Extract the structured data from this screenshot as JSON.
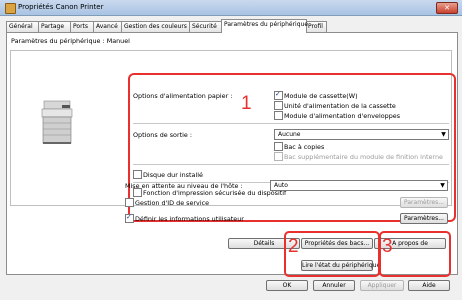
{
  "window": {
    "title": "Propriétés Canon Printer",
    "close_glyph": "✕"
  },
  "tabs": [
    "Général",
    "Partage",
    "Ports",
    "Avancé",
    "Gestion des couleurs",
    "Sécurité",
    "Paramètres du périphérique",
    "Profil"
  ],
  "panel": {
    "header": "Paramètres du périphérique : Manuel",
    "paper_source": {
      "label": "Options d'alimentation papier :",
      "options": [
        {
          "label": "Module de cassette(W)",
          "checked": true
        },
        {
          "label": "Unité d'alimentation de la cassette",
          "checked": false
        },
        {
          "label": "Module d'alimentation d'enveloppes",
          "checked": false
        }
      ]
    },
    "output": {
      "label": "Options de sortie :",
      "selected": "Aucune",
      "options": [
        {
          "label": "Bac à copies",
          "checked": false,
          "enabled": true
        },
        {
          "label": "Bac supplémentaire du module de finition interne",
          "checked": false,
          "enabled": false
        }
      ]
    },
    "hard_disk": {
      "label": "Disque dur installé",
      "checked": false
    },
    "secure_print": {
      "label": "Fonction d'impression sécurisée du dispositif",
      "checked": false
    },
    "sleep": {
      "label": "Mise en attente au niveau de l'hôte :",
      "selected": "Auto"
    },
    "id_mgmt": {
      "label": "Gestion d'ID de service",
      "checked": false,
      "button": "Paramètres..."
    },
    "user_info": {
      "label": "Définir les informations utilisateur",
      "checked": true,
      "button": "Paramètres..."
    },
    "details_button": "Détails",
    "paper_source_button": "Propriétés des bacs...",
    "read_status_button": "Lire l'état du périphérique",
    "about_button": "A propos de",
    "callouts": [
      "1",
      "2",
      "3"
    ]
  },
  "footer": {
    "ok": "OK",
    "cancel": "Annuler",
    "apply": "Appliquer",
    "help": "Aide"
  },
  "colors": {
    "callout": "#e8312e",
    "title_bar": "#b8cde9"
  }
}
